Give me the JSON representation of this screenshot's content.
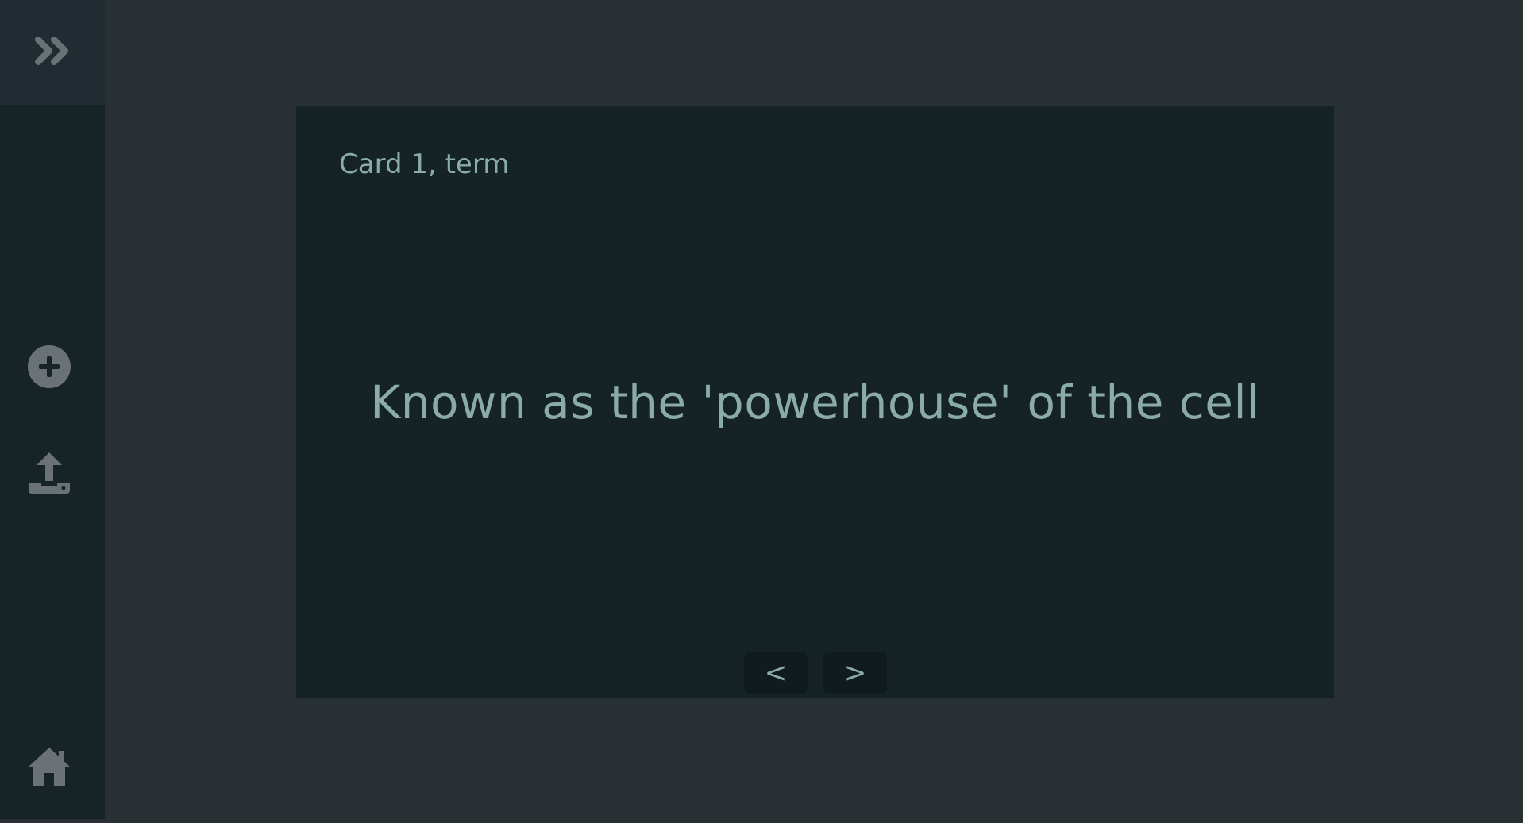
{
  "sidebar": {
    "toggle_icon": "chevrons-right-icon",
    "items": [
      {
        "icon": "plus-circle-icon"
      },
      {
        "icon": "upload-icon"
      },
      {
        "icon": "home-icon"
      }
    ],
    "icon_color": "#6b7276"
  },
  "card": {
    "label": "Card 1, term",
    "text": "Known as the 'powerhouse' of the cell",
    "text_color": "#8aaba7",
    "background": "#152327"
  },
  "nav": {
    "prev_label": "<",
    "next_label": ">"
  }
}
